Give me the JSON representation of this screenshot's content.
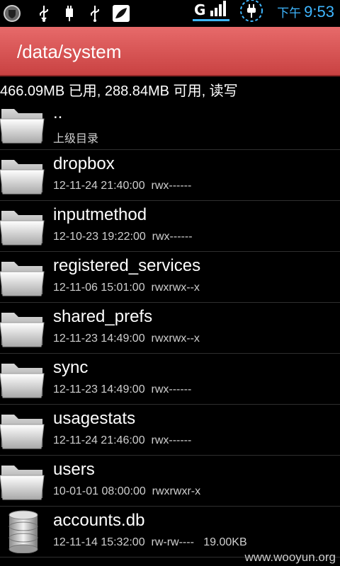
{
  "status_bar": {
    "network_type": "G",
    "time_ampm": "下午",
    "time": "9:53",
    "accent_color": "#3fb6ff",
    "icons": [
      "shield-icon",
      "usb-icon",
      "usb-connect-icon",
      "usb-icon",
      "leaf-app-icon",
      "signal-icon",
      "charging-icon"
    ]
  },
  "header": {
    "path": "/data/system",
    "color": "#d65252"
  },
  "storage_info": "466.09MB 已用, 288.84MB 可用, 读写",
  "files": [
    {
      "name": "..",
      "date": "",
      "perms": "",
      "size": "",
      "subtitle": "上级目录",
      "type": "folder"
    },
    {
      "name": "dropbox",
      "date": "12-11-24 21:40:00",
      "perms": "rwx------",
      "size": "",
      "type": "folder"
    },
    {
      "name": "inputmethod",
      "date": "12-10-23 19:22:00",
      "perms": "rwx------",
      "size": "",
      "type": "folder"
    },
    {
      "name": "registered_services",
      "date": "12-11-06 15:01:00",
      "perms": "rwxrwx--x",
      "size": "",
      "type": "folder"
    },
    {
      "name": "shared_prefs",
      "date": "12-11-23 14:49:00",
      "perms": "rwxrwx--x",
      "size": "",
      "type": "folder"
    },
    {
      "name": "sync",
      "date": "12-11-23 14:49:00",
      "perms": "rwx------",
      "size": "",
      "type": "folder"
    },
    {
      "name": "usagestats",
      "date": "12-11-24 21:46:00",
      "perms": "rwx------",
      "size": "",
      "type": "folder"
    },
    {
      "name": "users",
      "date": "10-01-01 08:00:00",
      "perms": "rwxrwxr-x",
      "size": "",
      "type": "folder"
    },
    {
      "name": "accounts.db",
      "date": "12-11-14 15:32:00",
      "perms": "rw-rw----",
      "size": "19.00KB",
      "type": "database"
    }
  ],
  "watermark": "www.wooyun.org"
}
